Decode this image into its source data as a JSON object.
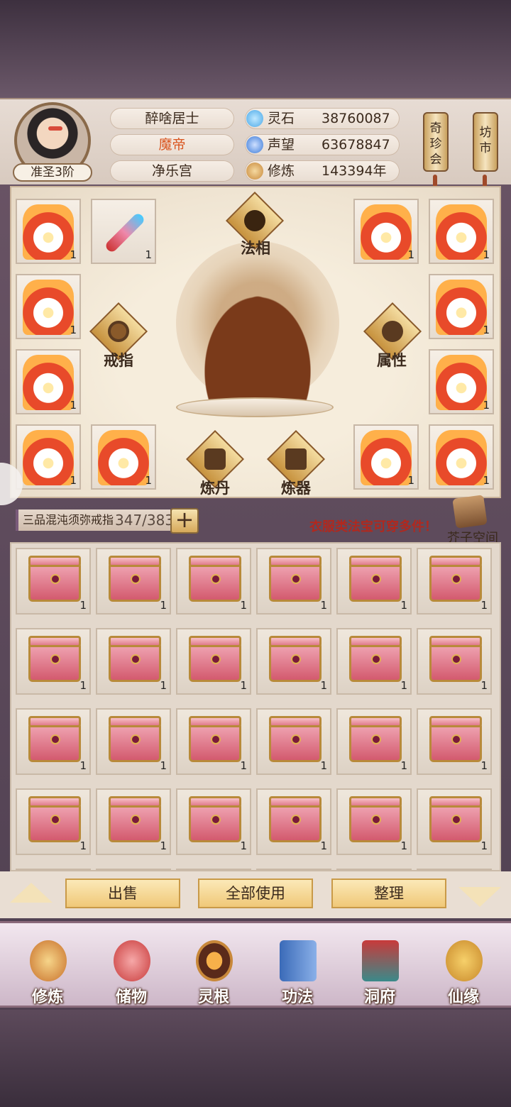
{
  "profile": {
    "rank": "准圣3阶",
    "name": "醉啥居士",
    "title": "魔帝",
    "sect": "净乐宫"
  },
  "stats": [
    {
      "label": "灵石",
      "value": "38760087",
      "icon": "spirit-stone-icon",
      "color": "#4aa8e8"
    },
    {
      "label": "声望",
      "value": "63678847",
      "icon": "reputation-icon",
      "color": "#3a7ad8"
    },
    {
      "label": "修炼",
      "value": "143394年",
      "icon": "cultivation-icon",
      "color": "#c8883a"
    }
  ],
  "top_buttons": [
    "奇珍会",
    "坊市"
  ],
  "equipment": {
    "center_labels": {
      "faxiang": "法相",
      "ring": "戒指",
      "attribute": "属性",
      "alchemy": "炼丹",
      "forge": "炼器"
    },
    "slot_count": "1"
  },
  "storage": {
    "ring_name": "三品混沌须弥戒指",
    "capacity": "347/383",
    "add_label": "+",
    "notice": "衣服类法宝可穿多件！",
    "space_label": "芥子空间",
    "item_count": "1"
  },
  "actions": {
    "sell": "出售",
    "use_all": "全部使用",
    "sort": "整理"
  },
  "nav": [
    "修炼",
    "储物",
    "灵根",
    "功法",
    "洞府",
    "仙缘"
  ]
}
